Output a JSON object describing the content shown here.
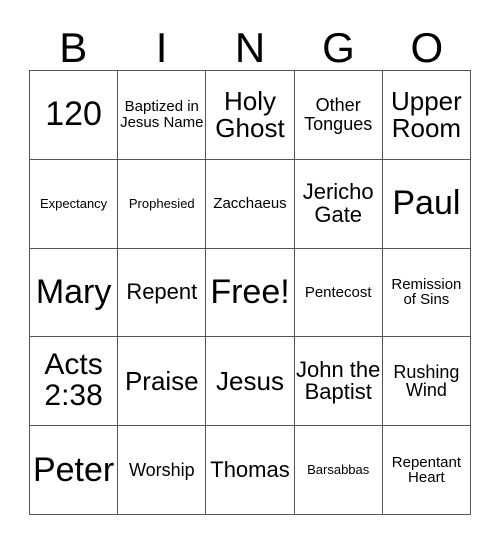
{
  "card": {
    "title": "BINGO Card",
    "columns": [
      "B",
      "I",
      "N",
      "G",
      "O"
    ],
    "free_space_label": "Free!",
    "grid_size": "5x5",
    "border_color": "#555555",
    "text_color": "#000000",
    "background_color": "#ffffff",
    "rows": [
      [
        {
          "text": "120",
          "size": "fs-xxl"
        },
        {
          "text": "Baptized in Jesus Name",
          "size": "fs-xs"
        },
        {
          "text": "Holy Ghost",
          "size": "fs-lg"
        },
        {
          "text": "Other Tongues",
          "size": "fs-sm"
        },
        {
          "text": "Upper Room",
          "size": "fs-lg"
        }
      ],
      [
        {
          "text": "Expectancy",
          "size": "fs-xxs"
        },
        {
          "text": "Prophesied",
          "size": "fs-xxs"
        },
        {
          "text": "Zacchaeus",
          "size": "fs-xs"
        },
        {
          "text": "Jericho Gate",
          "size": "fs-md"
        },
        {
          "text": "Paul",
          "size": "fs-xxl"
        }
      ],
      [
        {
          "text": "Mary",
          "size": "fs-xxl"
        },
        {
          "text": "Repent",
          "size": "fs-md"
        },
        {
          "text": "Free!",
          "size": "fs-xxl"
        },
        {
          "text": "Pentecost",
          "size": "fs-xs"
        },
        {
          "text": "Remission of Sins",
          "size": "fs-xs"
        }
      ],
      [
        {
          "text": "Acts 2:38",
          "size": "fs-xl"
        },
        {
          "text": "Praise",
          "size": "fs-lg"
        },
        {
          "text": "Jesus",
          "size": "fs-lg"
        },
        {
          "text": "John the Baptist",
          "size": "fs-md"
        },
        {
          "text": "Rushing Wind",
          "size": "fs-sm"
        }
      ],
      [
        {
          "text": "Peter",
          "size": "fs-xxl"
        },
        {
          "text": "Worship",
          "size": "fs-sm"
        },
        {
          "text": "Thomas",
          "size": "fs-md"
        },
        {
          "text": "Barsabbas",
          "size": "fs-xxs"
        },
        {
          "text": "Repentant Heart",
          "size": "fs-xs"
        }
      ]
    ]
  }
}
